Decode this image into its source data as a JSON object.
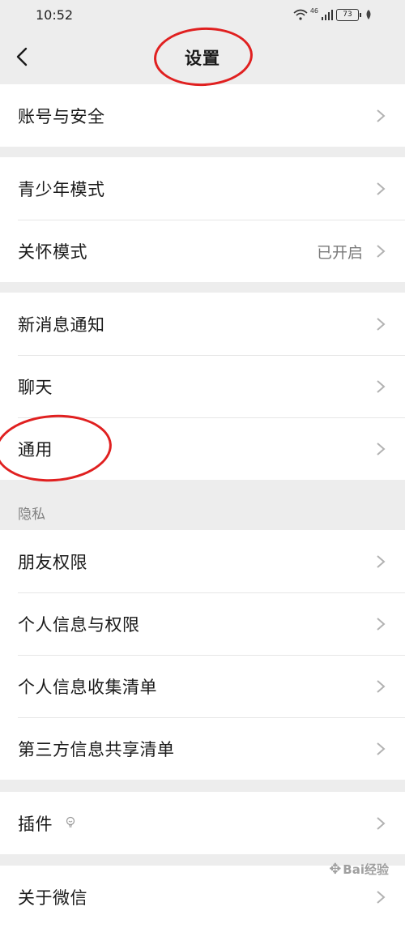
{
  "status_bar": {
    "time": "10:52",
    "network_label": "46",
    "battery_level": "73",
    "icons": [
      "wifi-icon",
      "signal-icon",
      "battery-icon",
      "leaf-icon"
    ]
  },
  "nav": {
    "title": "设置",
    "back_icon": "chevron-left-icon"
  },
  "groups": [
    {
      "items": [
        {
          "label": "账号与安全",
          "value": ""
        }
      ]
    },
    {
      "items": [
        {
          "label": "青少年模式",
          "value": ""
        },
        {
          "label": "关怀模式",
          "value": "已开启"
        }
      ]
    },
    {
      "items": [
        {
          "label": "新消息通知",
          "value": ""
        },
        {
          "label": "聊天",
          "value": ""
        },
        {
          "label": "通用",
          "value": ""
        }
      ]
    },
    {
      "header": "隐私",
      "items": [
        {
          "label": "朋友权限",
          "value": ""
        },
        {
          "label": "个人信息与权限",
          "value": ""
        },
        {
          "label": "个人信息收集清单",
          "value": ""
        },
        {
          "label": "第三方信息共享清单",
          "value": ""
        }
      ]
    },
    {
      "items": [
        {
          "label": "插件",
          "value": "",
          "icon": "lightbulb-icon"
        }
      ]
    },
    {
      "items": [
        {
          "label": "关于微信",
          "value": ""
        }
      ]
    }
  ],
  "annotations": {
    "color": "#e02020",
    "highlighted": [
      "设置",
      "通用"
    ]
  },
  "watermark": {
    "text": "Bai经验"
  },
  "colors": {
    "background": "#ededed",
    "card": "#ffffff",
    "secondary_text": "#7a7a7a"
  }
}
